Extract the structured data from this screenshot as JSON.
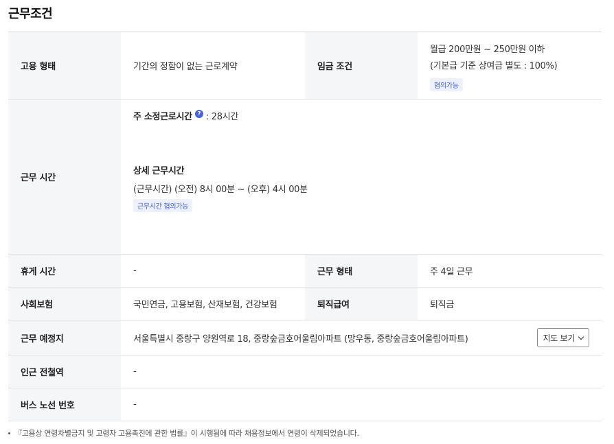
{
  "section_title": "근무조건",
  "employment": {
    "label": "고용 형태",
    "value": "기간의 정함이 없는 근로계약"
  },
  "wage": {
    "label": "임금 조건",
    "line1": "월급 200만원 ~ 250만원 이하",
    "line2": "(기본급 기준 상여금 별도 : 100%)",
    "badge": "협의가능"
  },
  "work_hours": {
    "label": "근무 시간",
    "weekly_label": "주 소정근로시간",
    "help_icon": "?",
    "weekly_value": ": 28시간",
    "detail_label": "상세 근무시간",
    "detail_value": "(근무시간) (오전) 8시 00분 ~ (오후) 4시 00분",
    "badge": "근무시간 협의가능"
  },
  "break": {
    "label": "휴게 시간",
    "value": "-"
  },
  "work_type": {
    "label": "근무 형태",
    "value": "주 4일 근무"
  },
  "insurance": {
    "label": "사회보험",
    "value": "국민연금, 고용보험, 산재보험, 건강보험"
  },
  "severance": {
    "label": "퇴직급여",
    "value": "퇴직금"
  },
  "location": {
    "label": "근무 예정지",
    "value": "서울특별시 중랑구 양원역로 18, 중랑숲금호어울림아파트 (망우동, 중랑숲금호어울림아파트)",
    "map_button": "지도 보기"
  },
  "subway": {
    "label": "인근 전철역",
    "value": "-"
  },
  "bus": {
    "label": "버스 노선 번호",
    "value": "-"
  },
  "footnote": "『고용상 연령차별금지 및 고령자 고용촉진에 관한 법률』이 시행됨에 따라 채용정보에서 연령이 삭제되었습니다."
}
